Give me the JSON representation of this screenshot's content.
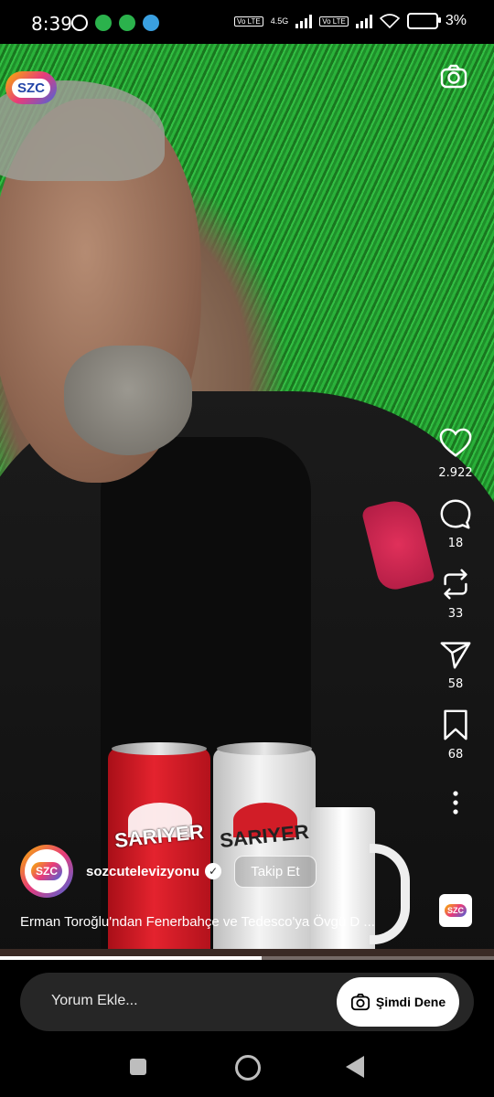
{
  "status_bar": {
    "time": "8:39",
    "network": "4.5G",
    "volte_label": "Vo LTE",
    "battery": "3%"
  },
  "header": {
    "channel_logo": "SZC"
  },
  "actions": {
    "like_count": "2.922",
    "comment_count": "18",
    "repost_count": "33",
    "share_count": "58",
    "save_count": "68"
  },
  "post": {
    "username": "sozcutelevizyonu",
    "avatar_text": "SZC",
    "follow_label": "Takip Et",
    "caption": "Erman Toroğlu'ndan Fenerbahçe ve Tedesco'ya Övgü D ...",
    "music_thumb": "SZC",
    "progress": 0.53
  },
  "scene": {
    "can_red_label": "SARIYER",
    "can_white_label": "SARIYER"
  },
  "comment_bar": {
    "placeholder": "Yorum Ekle...",
    "try_label": "Şimdi Dene"
  },
  "colors": {
    "accent": "#ffffff",
    "bar_bg": "#262626"
  }
}
